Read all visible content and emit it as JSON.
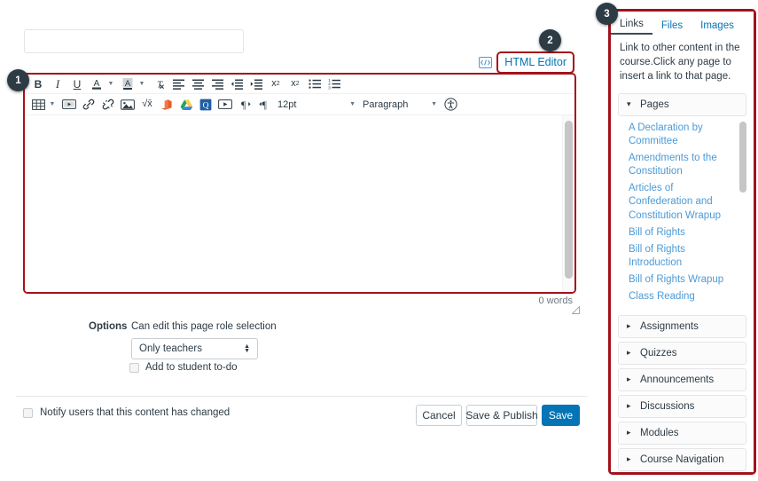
{
  "colors": {
    "annotation_red": "#a3121b",
    "link_blue": "#0374b5",
    "page_link_blue": "#4d9ad6",
    "primary_button": "#0374b5",
    "text": "#2d3b45",
    "badge_bg": "#2d3b45"
  },
  "title_field": {
    "name": "page-title-input",
    "value": "",
    "placeholder": ""
  },
  "html_editor": {
    "icon": "html-embed-icon",
    "label": "HTML Editor"
  },
  "badges": [
    {
      "number": "1",
      "target": "rich-content-editor-toolbar"
    },
    {
      "number": "2",
      "target": "html-editor-link"
    },
    {
      "number": "3",
      "target": "content-selector-sidebar"
    }
  ],
  "toolbar": {
    "row1": [
      {
        "name": "bold-icon",
        "label": "B",
        "kind": "text",
        "style": "bold"
      },
      {
        "name": "italic-icon",
        "label": "I",
        "kind": "text",
        "style": "italic"
      },
      {
        "name": "underline-icon",
        "label": "U",
        "kind": "text",
        "style": "underline"
      },
      {
        "name": "text-color-icon",
        "label": "A",
        "kind": "color-a",
        "caret": true
      },
      {
        "name": "background-color-icon",
        "label": "A",
        "kind": "highlight-a",
        "caret": true
      },
      {
        "name": "clear-formatting-icon",
        "label": "Tx",
        "kind": "clear"
      },
      {
        "name": "align-left-icon",
        "kind": "align",
        "variant": "left"
      },
      {
        "name": "align-center-icon",
        "kind": "align",
        "variant": "center"
      },
      {
        "name": "align-right-icon",
        "kind": "align",
        "variant": "right"
      },
      {
        "name": "outdent-icon",
        "kind": "indent",
        "variant": "out"
      },
      {
        "name": "indent-icon",
        "kind": "indent",
        "variant": "in"
      },
      {
        "name": "superscript-icon",
        "label": "x²",
        "kind": "sup"
      },
      {
        "name": "subscript-icon",
        "label": "x₂",
        "kind": "sub"
      },
      {
        "name": "bulleted-list-icon",
        "kind": "list",
        "variant": "bullet"
      },
      {
        "name": "numbered-list-icon",
        "kind": "list",
        "variant": "number"
      }
    ],
    "row2": [
      {
        "name": "table-icon",
        "kind": "table",
        "caret": true
      },
      {
        "name": "media-icon",
        "kind": "media"
      },
      {
        "name": "link-icon",
        "kind": "link"
      },
      {
        "name": "unlink-icon",
        "kind": "unlink"
      },
      {
        "name": "image-icon",
        "kind": "image"
      },
      {
        "name": "math-equation-icon",
        "label": "√x",
        "kind": "math"
      },
      {
        "name": "office-365-icon",
        "kind": "office"
      },
      {
        "name": "google-drive-icon",
        "kind": "gdrive"
      },
      {
        "name": "quizzes-next-icon",
        "kind": "quiz"
      },
      {
        "name": "video-icon",
        "kind": "video"
      },
      {
        "name": "ltr-direction-icon",
        "kind": "ltr"
      },
      {
        "name": "rtl-direction-icon",
        "kind": "rtl"
      }
    ],
    "font_size": {
      "name": "font-size-select",
      "value": "12pt"
    },
    "format": {
      "name": "paragraph-format-select",
      "value": "Paragraph"
    },
    "accessibility": {
      "name": "accessibility-checker-icon"
    }
  },
  "editor_body": {
    "content": "",
    "word_count": "0 words"
  },
  "options": {
    "label": "Options",
    "role_label": "Can edit this page role selection",
    "role_select": {
      "name": "edit-role-select",
      "value": "Only teachers"
    },
    "todo_checkbox": {
      "label": "Add to student to-do",
      "checked": false
    }
  },
  "footer": {
    "notify_checkbox": {
      "label": "Notify users that this content has changed",
      "checked": false
    },
    "cancel_label": "Cancel",
    "save_publish_label": "Save & Publish",
    "save_label": "Save"
  },
  "sidebar": {
    "tabs": [
      {
        "label": "Links",
        "active": true
      },
      {
        "label": "Files",
        "active": false
      },
      {
        "label": "Images",
        "active": false
      }
    ],
    "description": "Link to other content in the course.Click any page to insert a link to that page.",
    "pages_group": {
      "label": "Pages",
      "expanded": true,
      "items": [
        "A Declaration by Committee",
        "Amendments to the Constitution",
        "Articles of Confederation and Constitution Wrapup",
        "Bill of Rights",
        "Bill of Rights Introduction",
        "Bill of Rights Wrapup",
        "Class Reading"
      ]
    },
    "groups": [
      {
        "label": "Assignments",
        "expanded": false
      },
      {
        "label": "Quizzes",
        "expanded": false
      },
      {
        "label": "Announcements",
        "expanded": false
      },
      {
        "label": "Discussions",
        "expanded": false
      },
      {
        "label": "Modules",
        "expanded": false
      },
      {
        "label": "Course Navigation",
        "expanded": false
      }
    ]
  }
}
